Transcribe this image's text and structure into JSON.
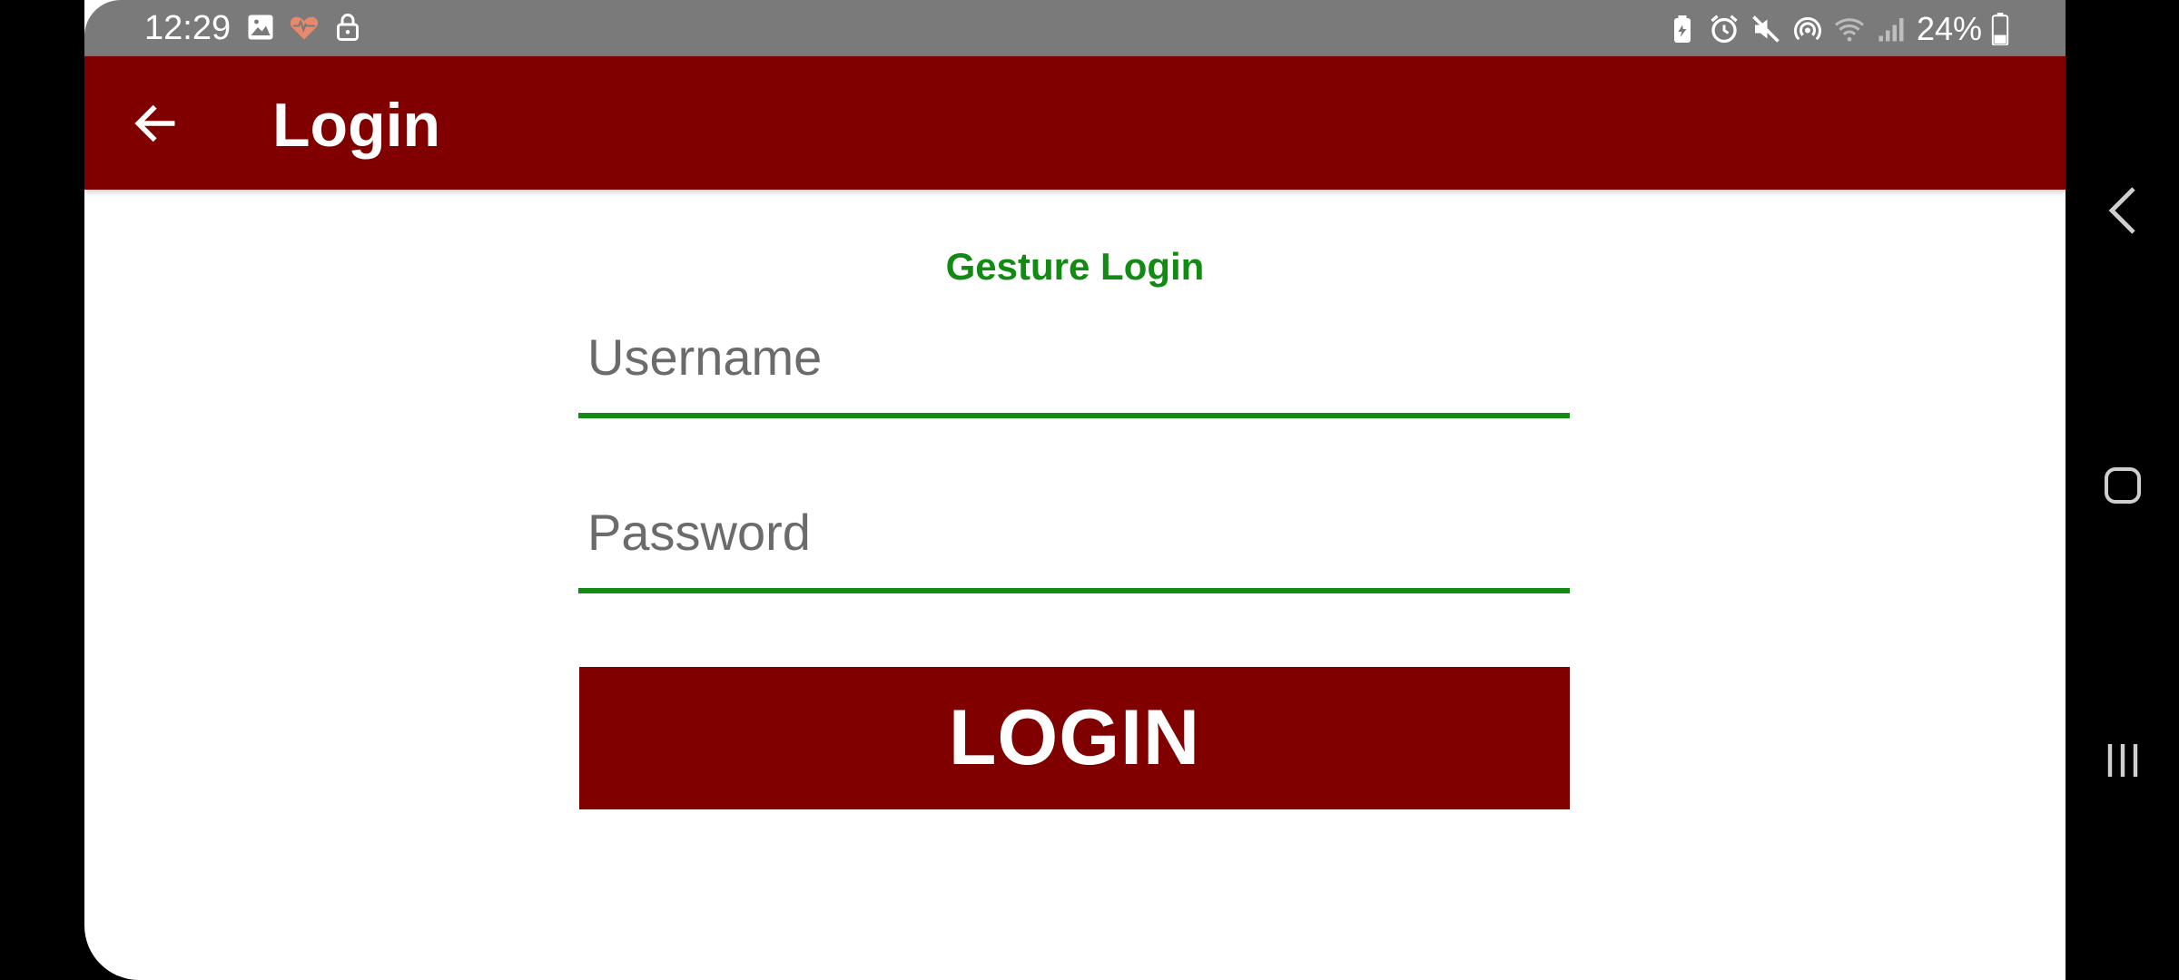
{
  "status_bar": {
    "time": "12:29",
    "battery": "24%",
    "left_icons": [
      "image-icon",
      "heart-rate-icon",
      "lock-icon"
    ],
    "right_icons": [
      "battery-saver-icon",
      "alarm-icon",
      "mute-icon",
      "hotspot-icon",
      "wifi-icon",
      "signal-icon",
      "battery-icon"
    ]
  },
  "app_bar": {
    "title": "Login",
    "back_icon": "arrow-left-icon",
    "background": "#800000"
  },
  "form": {
    "gesture_login_label": "Gesture Login",
    "username_placeholder": "Username",
    "password_placeholder": "Password",
    "login_label": "LOGIN",
    "accent_color": "#138a13"
  },
  "nav_bar": {
    "back_icon": "nav-back-icon",
    "home_icon": "nav-home-icon",
    "recent_icon": "nav-recent-apps-icon"
  }
}
